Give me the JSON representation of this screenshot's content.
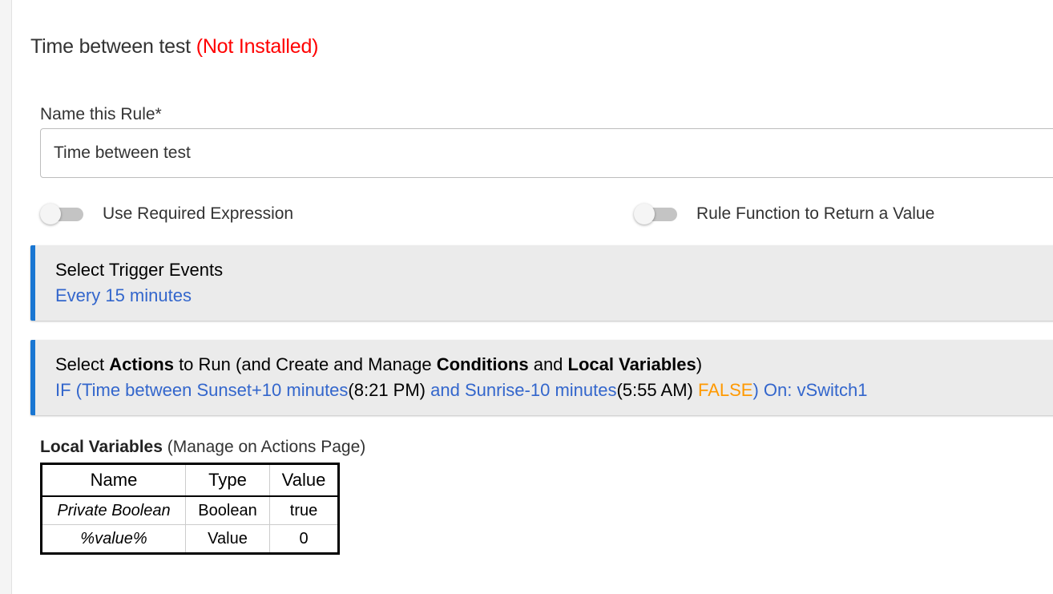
{
  "header": {
    "title": "Time between test",
    "status": "(Not Installed)"
  },
  "name_field": {
    "label": "Name this Rule*",
    "value": "Time between test"
  },
  "toggles": [
    {
      "label": "Use Required Expression",
      "on": false
    },
    {
      "label": "Rule Function to Return a Value",
      "on": false
    }
  ],
  "triggers": {
    "title": "Select Trigger Events",
    "detail": "Every 15 minutes"
  },
  "actions": {
    "title_pre": "Select ",
    "title_b1": "Actions",
    "title_mid1": " to Run (and Create and Manage ",
    "title_b2": "Conditions",
    "title_mid2": " and ",
    "title_b3": "Local Variables",
    "title_post": ")",
    "detail": {
      "part1": "IF (Time between Sunset+10 minutes",
      "time1": "(8:21 PM)",
      "part2": " and Sunrise-10 minutes",
      "time2": "(5:55 AM)",
      "state": " FALSE",
      "part3": ") On: vSwitch1"
    }
  },
  "local_variables": {
    "title": "Local Variables",
    "note": " (Manage on Actions Page)",
    "columns": [
      "Name",
      "Type",
      "Value"
    ],
    "rows": [
      {
        "name": "Private Boolean",
        "type": "Boolean",
        "value": "true"
      },
      {
        "name": "%value%",
        "type": "Value",
        "value": "0"
      }
    ]
  },
  "colors": {
    "accent": "#1976d2",
    "link": "#3366cc",
    "status_red": "#ff0000",
    "false_orange": "#ff9900"
  }
}
